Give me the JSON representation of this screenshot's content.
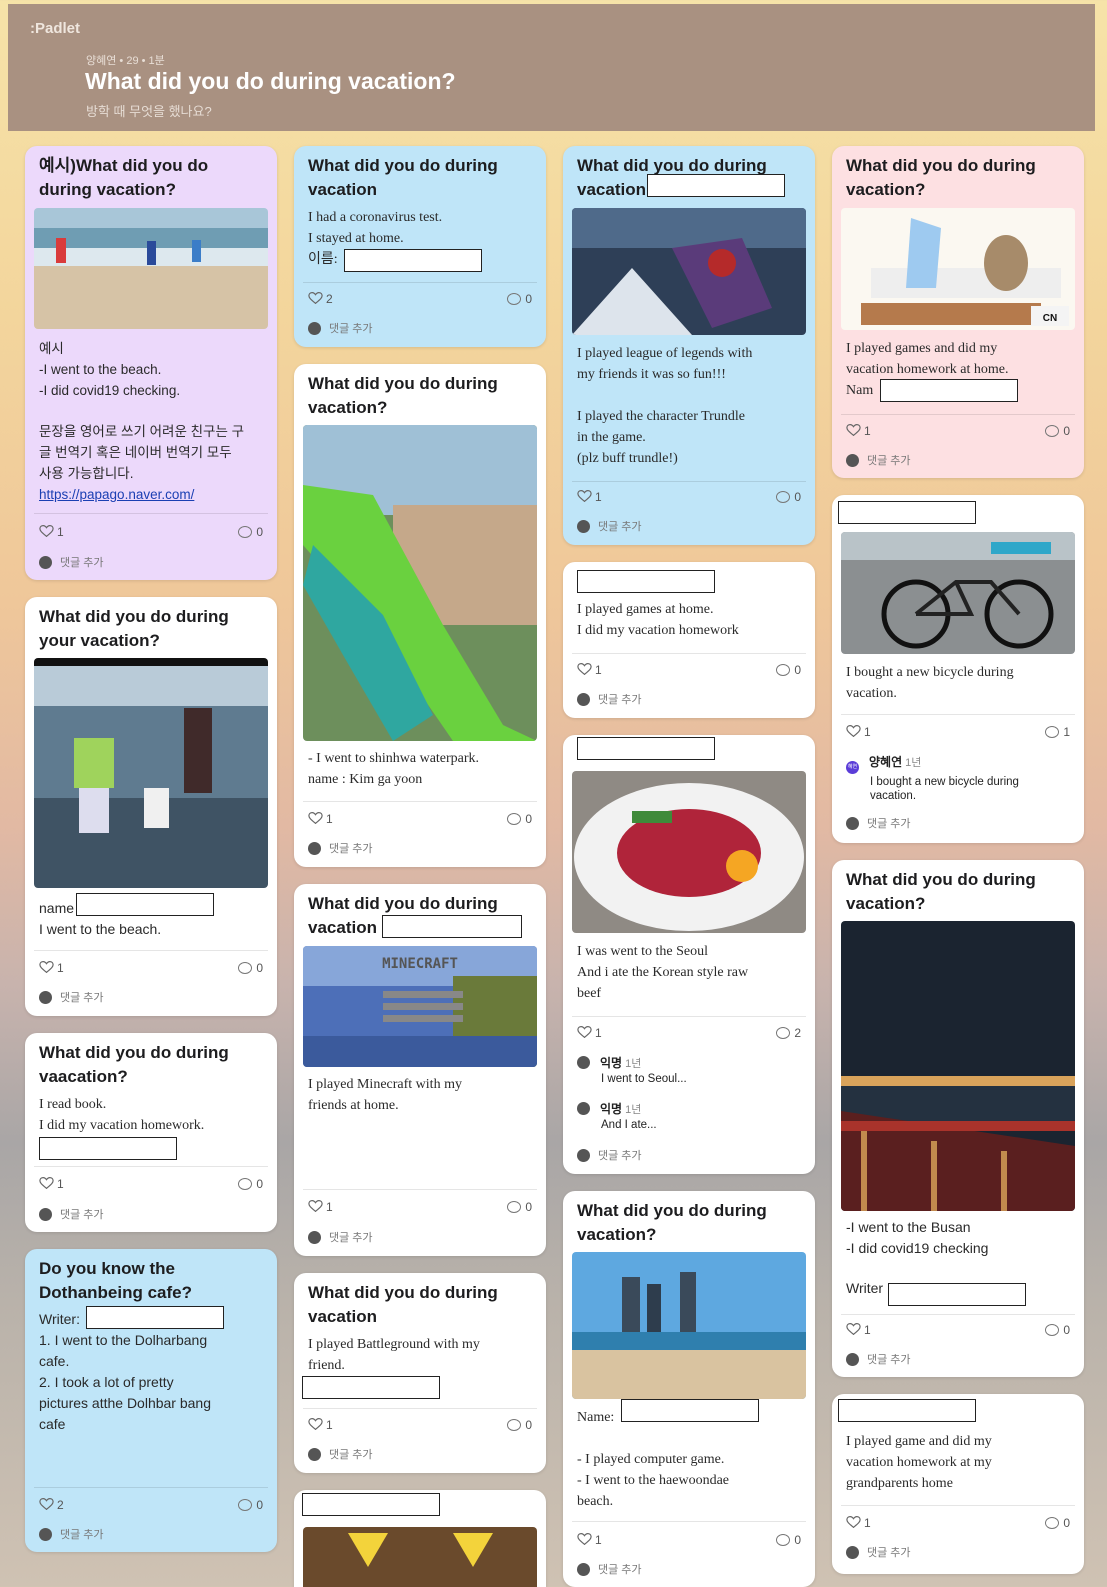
{
  "header": {
    "logo": ":Padlet",
    "meta": "양혜연 • 29 • 1분",
    "title": "What did you do during vacation?",
    "subtitle": "방학 때 무엇을 했나요?"
  },
  "common": {
    "add_comment": "댓글 추가"
  },
  "cards": {
    "c1": {
      "title_l1": "예시)What did you do",
      "title_l2": "during vacation?",
      "body": [
        "예시",
        "-I went to the beach.",
        "-I did covid19 checking.",
        "",
        "문장을 영어로 쓰기 어려운 친구는 구",
        "글 번역기 혹은 네이버 번역기 모두",
        "사용 가능합니다."
      ],
      "link": "https://papago.naver.com/",
      "likes": "1",
      "comments": "0"
    },
    "c2": {
      "title_l1": "What did you do during",
      "title_l2": "your vacation?",
      "body_l1": "name",
      "body_l2": "I went to the beach.",
      "likes": "1",
      "comments": "0"
    },
    "c3": {
      "title_l1": "What did you do during",
      "title_l2": "vaacation?",
      "body_l1": "I read book.",
      "body_l2": "I did my vacation homework.",
      "likes": "1",
      "comments": "0"
    },
    "c4": {
      "title_l1": "Do you know the",
      "title_l2": "Dothanbeing cafe?",
      "body": [
        "Writer:",
        "1. I went to the Dolharbang",
        "cafe.",
        "2. I took a lot of pretty",
        "pictures atthe Dolhbar bang",
        "cafe"
      ],
      "likes": "2",
      "comments": "0"
    },
    "c5": {
      "title_l1": "What did you do during",
      "title_l2": "vacation",
      "body_l1": "I had a coronavirus test.",
      "body_l2": "I stayed at home.",
      "body_l3": "이름:",
      "likes": "2",
      "comments": "0"
    },
    "c6": {
      "title_l1": "What did you do during",
      "title_l2": "vacation?",
      "body_l1": "- I went to shinhwa waterpark.",
      "body_l2": "name : Kim ga yoon",
      "likes": "1",
      "comments": "0"
    },
    "c7": {
      "title_l1": "What did you do during",
      "title_l2": "vacation",
      "img_text": "MINECRAFT",
      "body_l1": "I played Minecraft with my",
      "body_l2": "friends at home.",
      "likes": "1",
      "comments": "0"
    },
    "c8": {
      "title_l1": "What did you do during",
      "title_l2": "vacation",
      "body_l1": "I played Battleground with my",
      "body_l2": "friend.",
      "likes": "1",
      "comments": "0"
    },
    "c10": {
      "title_l1": "What did you do during",
      "title_l2": "vacation",
      "body": [
        "I played league of legends with",
        "my friends it was so fun!!!",
        "",
        "I played the character Trundle",
        "in the game.",
        "(plz buff trundle!)"
      ],
      "likes": "1",
      "comments": "0"
    },
    "c11": {
      "body_l1": "I played games at home.",
      "body_l2": "I did my vacation homework",
      "likes": "1",
      "comments": "0"
    },
    "c12": {
      "body_l1": "I was went to the Seoul",
      "body_l2": "And i ate the Korean style raw",
      "body_l3": "beef",
      "likes": "1",
      "comments": "2",
      "comment1_author": "익명",
      "comment1_time": "1년",
      "comment1_text": "I went to Seoul...",
      "comment2_author": "익명",
      "comment2_time": "1년",
      "comment2_text": "And I ate..."
    },
    "c13": {
      "title_l1": "What did you do during",
      "title_l2": "vacation?",
      "body_l1": "Name:",
      "body_l2": "- I played computer game.",
      "body_l3": "- I went to the haewoondae",
      "body_l4": "beach.",
      "likes": "1",
      "comments": "0"
    },
    "c14": {
      "title_l1": "What did you do during",
      "title_l2": "vacation?",
      "img_badge": "CN",
      "body_l1": "I played games and did my",
      "body_l2": "vacation homework at home.",
      "body_l3": "Nam",
      "likes": "1",
      "comments": "0"
    },
    "c15": {
      "body_l1": "I bought a new bicycle during",
      "body_l2": "vacation.",
      "likes": "1",
      "comments": "1",
      "comment1_author": "양혜연",
      "comment1_time": "1년",
      "comment1_badge": "혜연",
      "comment1_text_l1": "I bought a new bicycle during",
      "comment1_text_l2": "vacation."
    },
    "c16": {
      "title_l1": "What did you do during",
      "title_l2": "vacation?",
      "body_l1": "-I went to the Busan",
      "body_l2": "-I did covid19 checking",
      "body_l3": "Writer",
      "likes": "1",
      "comments": "0"
    },
    "c17": {
      "body_l1": "I played game and did my",
      "body_l2": "vacation homework at my",
      "body_l3": "grandparents home",
      "likes": "1",
      "comments": "0"
    }
  }
}
